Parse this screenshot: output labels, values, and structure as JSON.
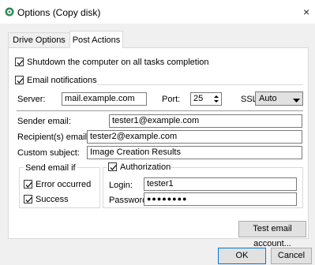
{
  "window": {
    "title": "Options (Copy disk)",
    "close_glyph": "×"
  },
  "tabs": [
    {
      "label": "Drive Options",
      "active": false
    },
    {
      "label": "Post Actions",
      "active": true
    }
  ],
  "post_actions": {
    "shutdown": {
      "label": "Shutdown the computer on all tasks completion",
      "checked": true
    },
    "email_notifications": {
      "label": "Email notifications",
      "checked": true
    },
    "server": {
      "label": "Server:",
      "value": "mail.example.com"
    },
    "port": {
      "label": "Port:",
      "value": "25"
    },
    "ssl": {
      "label": "SSL",
      "value": "Auto"
    },
    "sender": {
      "label": "Sender email:",
      "value": "tester1@example.com"
    },
    "recipient": {
      "label": "Recipient(s) email:",
      "value": "tester2@example.com"
    },
    "subject": {
      "label": "Custom subject:",
      "value": "Image Creation Results"
    },
    "send_if": {
      "label": "Send email if",
      "error": {
        "label": "Error occurred",
        "checked": true
      },
      "success": {
        "label": "Success",
        "checked": true
      }
    },
    "authorization": {
      "label": "Authorization",
      "checked": true,
      "login": {
        "label": "Login:",
        "value": "tester1"
      },
      "password": {
        "label": "Password:",
        "value": "●●●●●●●●"
      }
    },
    "test_button": "Test email account..."
  },
  "footer": {
    "ok": "OK",
    "cancel": "Cancel"
  },
  "colors": {
    "accent": "#0078d7",
    "icon": "#2e8b57"
  },
  "icons": {
    "app": "disk-clone-icon",
    "check": "check-icon",
    "dropdown": "chevron-down-icon",
    "spinner": "spinner-arrows-icon"
  }
}
